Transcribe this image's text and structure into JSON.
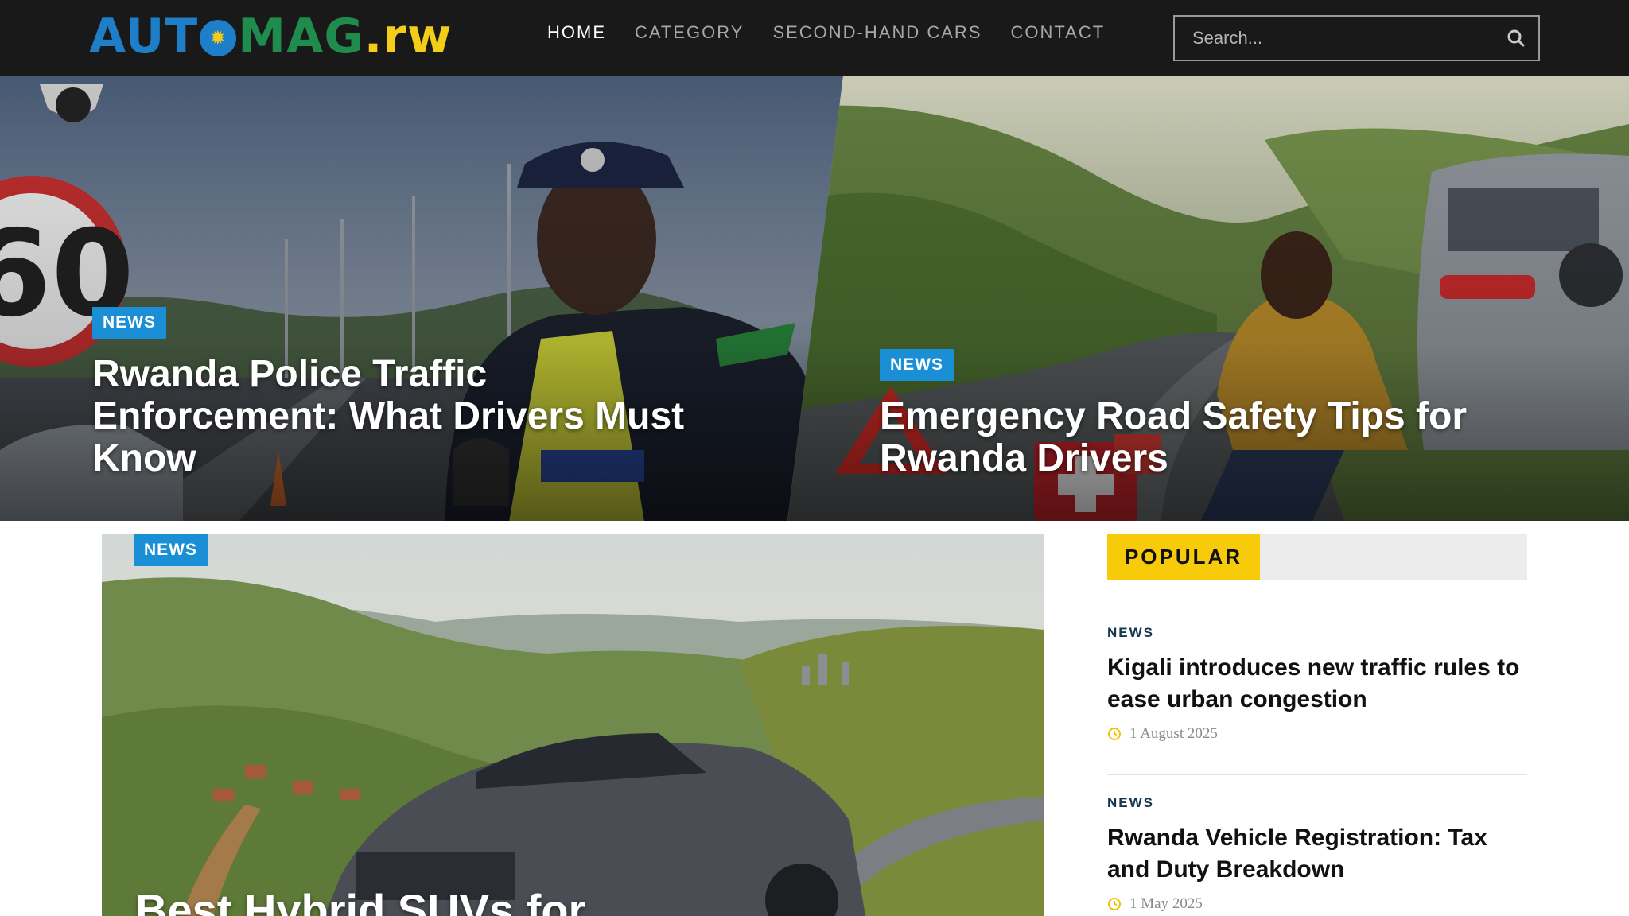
{
  "header": {
    "logo": {
      "part1": "AUT",
      "part2": "MAG",
      "part3": ".rw"
    },
    "nav": [
      "HOME",
      "CATEGORY",
      "SECOND-HAND CARS",
      "CONTACT"
    ],
    "search": {
      "placeholder": "Search..."
    }
  },
  "hero": [
    {
      "category": "NEWS",
      "title": "Rwanda Police Traffic Enforcement: What Drivers Must Know"
    },
    {
      "category": "NEWS",
      "title": "Emergency Road Safety Tips for Rwanda Drivers"
    }
  ],
  "featured": {
    "category": "NEWS",
    "title": "Best Hybrid SUVs for"
  },
  "popular": {
    "heading": "POPULAR",
    "posts": [
      {
        "category": "NEWS",
        "title": "Kigali introduces new traffic rules to ease urban congestion",
        "date": "1 August 2025"
      },
      {
        "category": "NEWS",
        "title": "Rwanda Vehicle Registration: Tax and Duty Breakdown",
        "date": "1 May 2025"
      }
    ]
  },
  "colors": {
    "header_bg": "#191919",
    "badge": "#1a8fd6",
    "popular_tab": "#f8cb0a",
    "logo_blue": "#1e7fc8",
    "logo_green": "#1f8b4c",
    "logo_yellow": "#f4cc1a"
  },
  "icons": {
    "search": "search-icon",
    "clock": "clock-icon"
  }
}
